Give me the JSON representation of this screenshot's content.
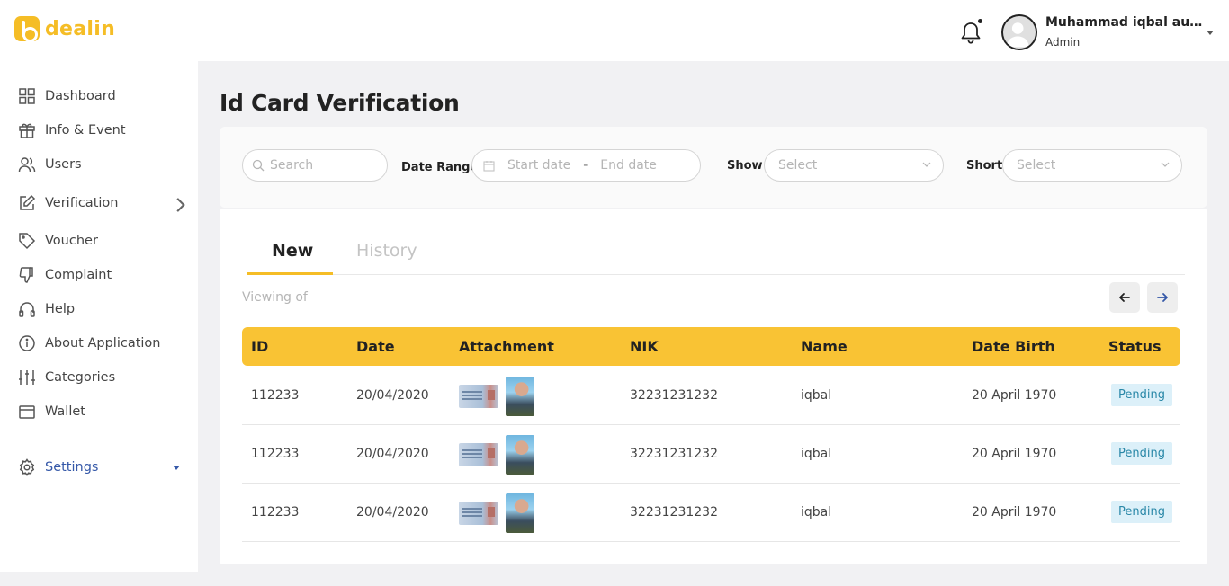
{
  "app": {
    "logo_text": "dealin"
  },
  "user": {
    "name": "Muhammad iqbal aulia...",
    "role": "Admin"
  },
  "sidebar": {
    "items": [
      {
        "label": "Dashboard",
        "icon": "grid-icon"
      },
      {
        "label": "Info & Event",
        "icon": "gift-icon"
      },
      {
        "label": "Users",
        "icon": "users-icon"
      },
      {
        "label": "Verification",
        "icon": "edit-icon"
      },
      {
        "label": "Voucher",
        "icon": "tag-icon"
      },
      {
        "label": "Complaint",
        "icon": "thumbs-down-icon"
      },
      {
        "label": "Help",
        "icon": "headphones-icon"
      },
      {
        "label": "About Application",
        "icon": "info-icon"
      },
      {
        "label": "Categories",
        "icon": "sliders-icon"
      },
      {
        "label": "Wallet",
        "icon": "wallet-icon"
      },
      {
        "label": "Settings",
        "icon": "gear-icon"
      }
    ]
  },
  "page": {
    "title": "Id Card Verification"
  },
  "filters": {
    "search_placeholder": "Search",
    "date_range_label": "Date Range",
    "start_date_placeholder": "Start date",
    "date_separator": "-",
    "end_date_placeholder": "End date",
    "show_label": "Show",
    "show_placeholder": "Select",
    "short_label": "Short",
    "short_placeholder": "Select"
  },
  "tabs": {
    "new": "New",
    "history": "History",
    "active": "New"
  },
  "viewing_text": "Viewing of",
  "table": {
    "headers": [
      "ID",
      "Date",
      "Attachment",
      "NIK",
      "Name",
      "Date Birth",
      "Status"
    ],
    "rows": [
      {
        "id": "112233",
        "date": "20/04/2020",
        "nik": "32231231232",
        "name": "iqbal",
        "birth": "20 April 1970",
        "status": "Pending"
      },
      {
        "id": "112233",
        "date": "20/04/2020",
        "nik": "32231231232",
        "name": "iqbal",
        "birth": "20 April 1970",
        "status": "Pending"
      },
      {
        "id": "112233",
        "date": "20/04/2020",
        "nik": "32231231232",
        "name": "iqbal",
        "birth": "20 April 1970",
        "status": "Pending"
      }
    ]
  },
  "colors": {
    "brand": "#f5bd26",
    "table_header": "#f9c334",
    "active_nav": "#3558a8",
    "pending_bg": "#dcf0f9",
    "pending_text": "#2a88a8"
  }
}
